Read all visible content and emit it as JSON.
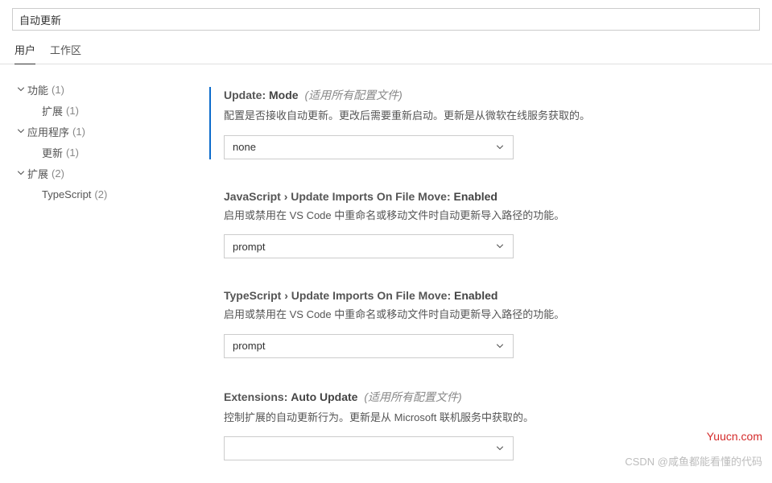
{
  "search": {
    "value": "自动更新"
  },
  "tabs": {
    "user": "用户",
    "workspace": "工作区"
  },
  "toc": {
    "items": [
      {
        "label": "功能",
        "count": "(1)",
        "expandable": true
      },
      {
        "label": "扩展",
        "count": "(1)",
        "child": true
      },
      {
        "label": "应用程序",
        "count": "(1)",
        "expandable": true
      },
      {
        "label": "更新",
        "count": "(1)",
        "child": true
      },
      {
        "label": "扩展",
        "count": "(2)",
        "expandable": true
      },
      {
        "label": "TypeScript",
        "count": "(2)",
        "child": true
      }
    ]
  },
  "settings": [
    {
      "crumb": "Update: ",
      "name": "Mode",
      "scope": "(适用所有配置文件)",
      "desc": "配置是否接收自动更新。更改后需要重新启动。更新是从微软在线服务获取的。",
      "value": "none",
      "modified": true
    },
    {
      "crumb": "JavaScript › Update Imports On File Move: ",
      "name": "Enabled",
      "scope": "",
      "desc": "启用或禁用在 VS Code 中重命名或移动文件时自动更新导入路径的功能。",
      "value": "prompt",
      "modified": false
    },
    {
      "crumb": "TypeScript › Update Imports On File Move: ",
      "name": "Enabled",
      "scope": "",
      "desc": "启用或禁用在 VS Code 中重命名或移动文件时自动更新导入路径的功能。",
      "value": "prompt",
      "modified": false
    },
    {
      "crumb": "Extensions: ",
      "name": "Auto Update",
      "scope": "(适用所有配置文件)",
      "desc": "控制扩展的自动更新行为。更新是从 Microsoft 联机服务中获取的。",
      "value": "",
      "modified": false
    }
  ],
  "watermarks": {
    "w1": "Yuucn.com",
    "w2": "CSDN @咸鱼都能看懂的代码"
  }
}
